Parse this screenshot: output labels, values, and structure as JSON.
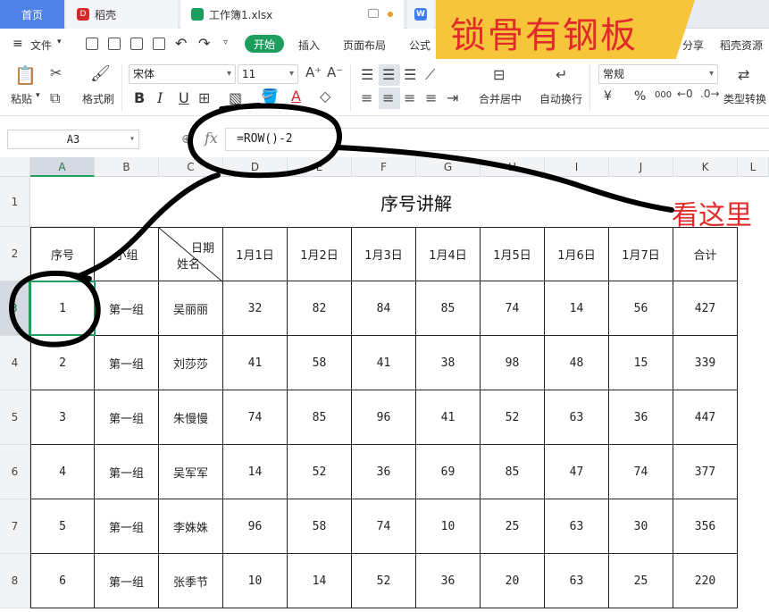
{
  "tabs": {
    "home": "首页",
    "daoke": "稻壳",
    "workbook": "工作簿1.xlsx"
  },
  "banner": {
    "text": "锁骨有钢板"
  },
  "menu": {
    "file": "文件",
    "start": "开始",
    "insert": "插入",
    "page_layout": "页面布局",
    "formula": "公式",
    "share": "分享",
    "daoke_res": "稻壳资源"
  },
  "ribbon": {
    "paste": "粘贴",
    "format_painter": "格式刷",
    "font_name": "宋体",
    "font_size": "11",
    "merge_center": "合并居中",
    "wrap_text": "自动换行",
    "number_format": "常规",
    "type_convert": "类型转换",
    "bold": "B",
    "italic": "I",
    "underline": "U",
    "currency": "¥",
    "percent": "%",
    "thousands": "000"
  },
  "formula_bar": {
    "name_box": "A3",
    "fx": "fx",
    "formula": "=ROW()-2"
  },
  "columns": [
    "A",
    "B",
    "C",
    "D",
    "E",
    "F",
    "G",
    "H",
    "I",
    "J",
    "K",
    "L"
  ],
  "rows": [
    "1",
    "2",
    "3",
    "4",
    "5",
    "6",
    "7",
    "8"
  ],
  "sheet": {
    "title": "序号讲解",
    "header_seq": "序号",
    "header_group": "小组",
    "header_diag_top": "日期",
    "header_diag_bottom": "姓名",
    "date_headers": [
      "1月1日",
      "1月2日",
      "1月3日",
      "1月4日",
      "1月5日",
      "1月6日",
      "1月7日"
    ],
    "header_total": "合计",
    "data": [
      {
        "seq": "1",
        "group": "第一组",
        "name": "吴丽丽",
        "vals": [
          "32",
          "82",
          "84",
          "85",
          "74",
          "14",
          "56"
        ],
        "total": "427"
      },
      {
        "seq": "2",
        "group": "第一组",
        "name": "刘莎莎",
        "vals": [
          "41",
          "58",
          "41",
          "38",
          "98",
          "48",
          "15"
        ],
        "total": "339"
      },
      {
        "seq": "3",
        "group": "第一组",
        "name": "朱慢慢",
        "vals": [
          "74",
          "85",
          "96",
          "41",
          "52",
          "63",
          "36"
        ],
        "total": "447"
      },
      {
        "seq": "4",
        "group": "第一组",
        "name": "吴军军",
        "vals": [
          "14",
          "52",
          "36",
          "69",
          "85",
          "47",
          "74"
        ],
        "total": "377"
      },
      {
        "seq": "5",
        "group": "第一组",
        "name": "李姝姝",
        "vals": [
          "96",
          "58",
          "74",
          "10",
          "25",
          "63",
          "30"
        ],
        "total": "356"
      },
      {
        "seq": "6",
        "group": "第一组",
        "name": "张季节",
        "vals": [
          "10",
          "14",
          "52",
          "36",
          "20",
          "63",
          "25"
        ],
        "total": "220"
      }
    ]
  },
  "annotation": {
    "text": "看这里"
  },
  "colors": {
    "accent": "#1d9e5f",
    "banner_bg": "#f6c53a",
    "banner_text": "#e12b2b"
  }
}
